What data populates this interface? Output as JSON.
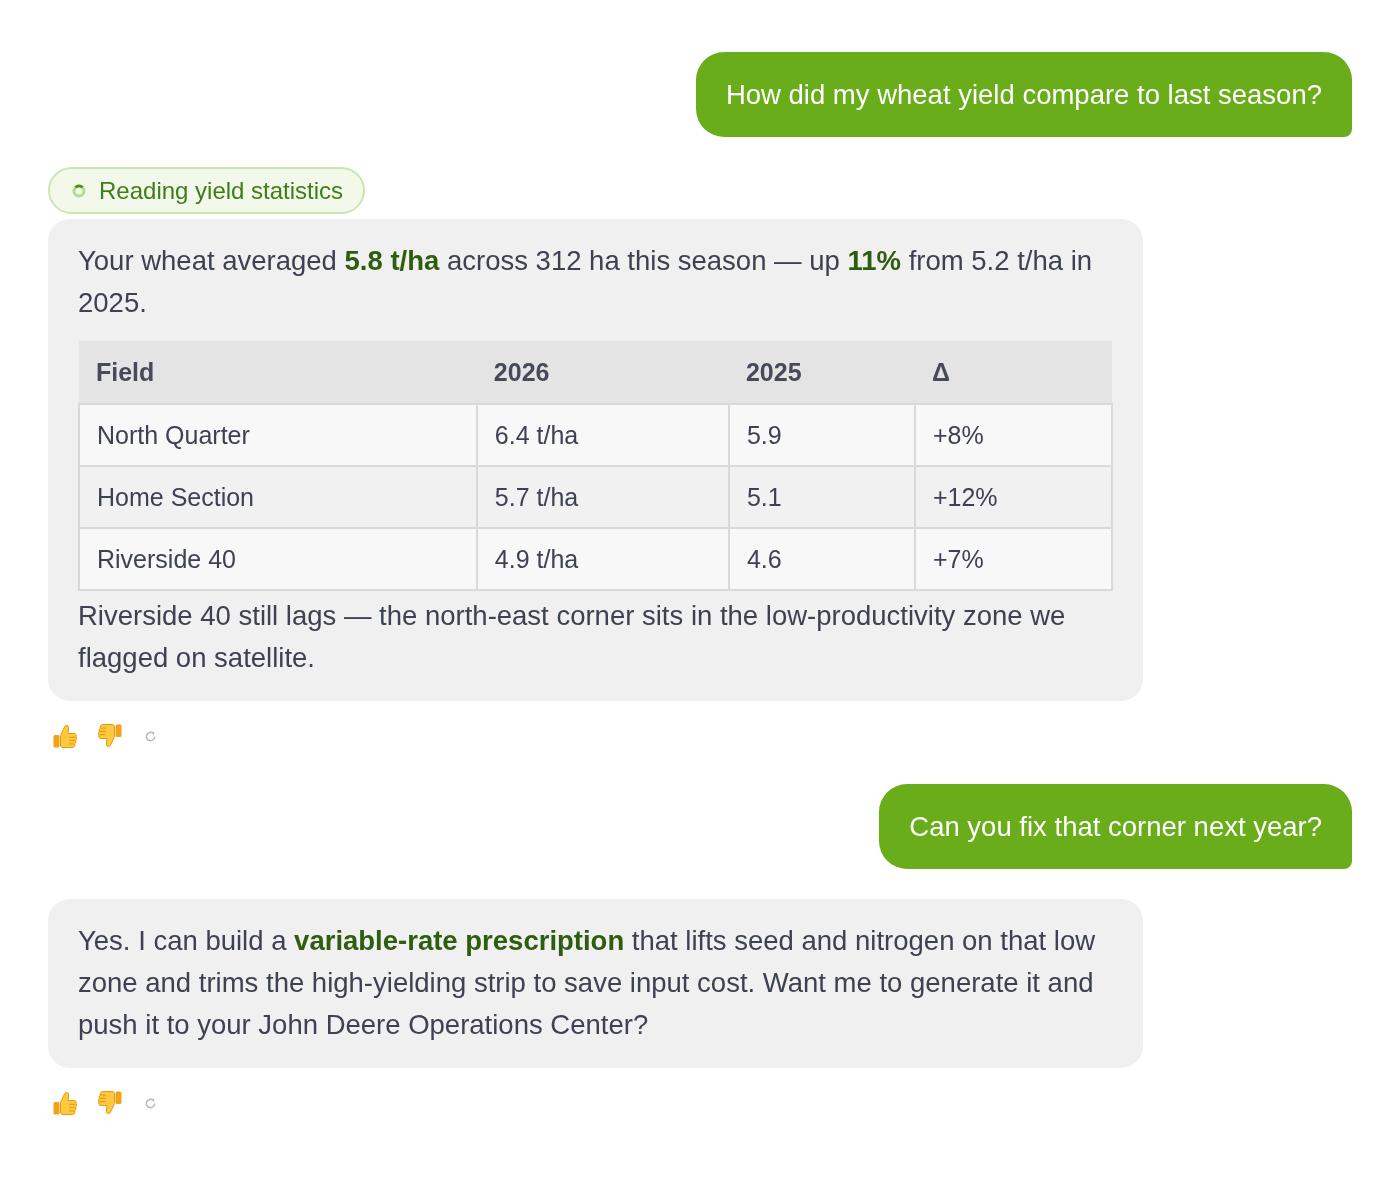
{
  "messages": [
    {
      "kind": "user",
      "text": "How did my wheat yield compare to last season?"
    },
    {
      "kind": "assistant",
      "status": {
        "label": "Reading yield statistics"
      },
      "blocks": [
        {
          "kind": "paragraph",
          "text": "Your wheat averaged **5.8 t/ha** across 312 ha this season — up **11%** from 5.2 t/ha in 2025."
        },
        {
          "kind": "table",
          "columns": [
            "Field",
            "2026",
            "2025",
            "Δ"
          ],
          "rows": [
            [
              "North Quarter",
              "6.4 t/ha",
              "5.9",
              "+8%"
            ],
            [
              "Home Section",
              "5.7 t/ha",
              "5.1",
              "+12%"
            ],
            [
              "Riverside 40",
              "4.9 t/ha",
              "4.6",
              "+7%"
            ]
          ]
        },
        {
          "kind": "paragraph",
          "text": "Riverside 40 still lags — the north-east corner sits in the low-productivity zone we flagged on satellite."
        }
      ]
    },
    {
      "kind": "user",
      "text": "Can you fix that corner next year?"
    },
    {
      "kind": "assistant",
      "blocks": [
        {
          "kind": "paragraph",
          "text": "Yes. I can build a **variable-rate prescription** that lifts seed and nitrogen on that low zone and trims the high-yielding strip to save input cost. Want me to generate it and push it to your John Deere Operations Center?"
        }
      ]
    }
  ]
}
